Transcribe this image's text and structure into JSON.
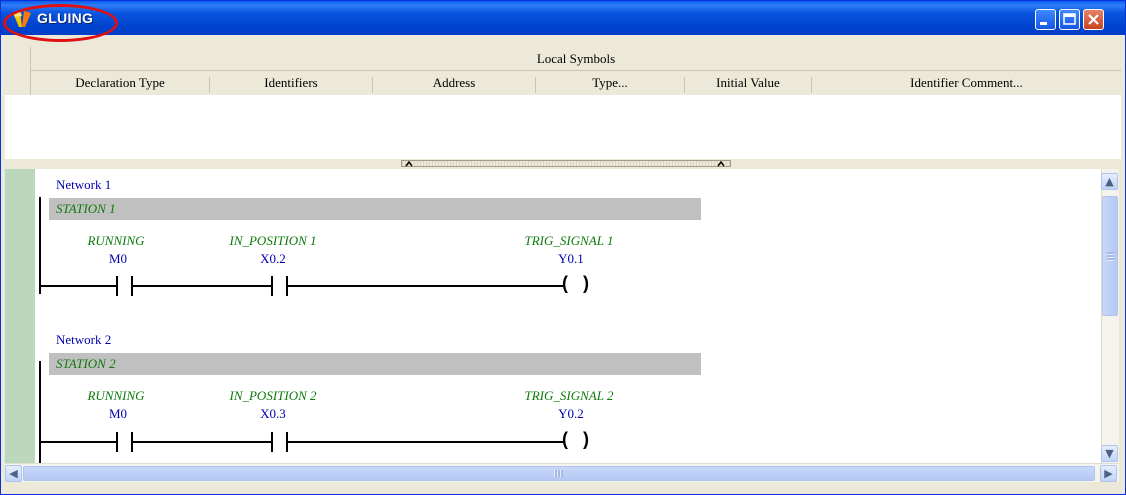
{
  "window": {
    "title": "GLUING"
  },
  "symbols": {
    "group_title": "Local Symbols",
    "columns": [
      "Declaration Type",
      "Identifiers",
      "Address",
      "Type...",
      "Initial Value",
      "Identifier Comment..."
    ]
  },
  "networks": [
    {
      "label": "Network 1",
      "comment": "STATION 1",
      "contacts": [
        {
          "symbol": "RUNNING",
          "address": "M0"
        },
        {
          "symbol": "IN_POSITION 1",
          "address": "X0.2"
        }
      ],
      "coil": {
        "symbol": "TRIG_SIGNAL 1",
        "address": "Y0.1"
      }
    },
    {
      "label": "Network 2",
      "comment": "STATION 2",
      "contacts": [
        {
          "symbol": "RUNNING",
          "address": "M0"
        },
        {
          "symbol": "IN_POSITION 2",
          "address": "X0.3"
        }
      ],
      "coil": {
        "symbol": "TRIG_SIGNAL 2",
        "address": "Y0.2"
      }
    }
  ],
  "colors": {
    "titlebar": "#0045d0",
    "symbol_text": "#0b7a0b",
    "address_text": "#0000b0",
    "highlight": "#e01010",
    "gutter": "#bcd8bc"
  }
}
